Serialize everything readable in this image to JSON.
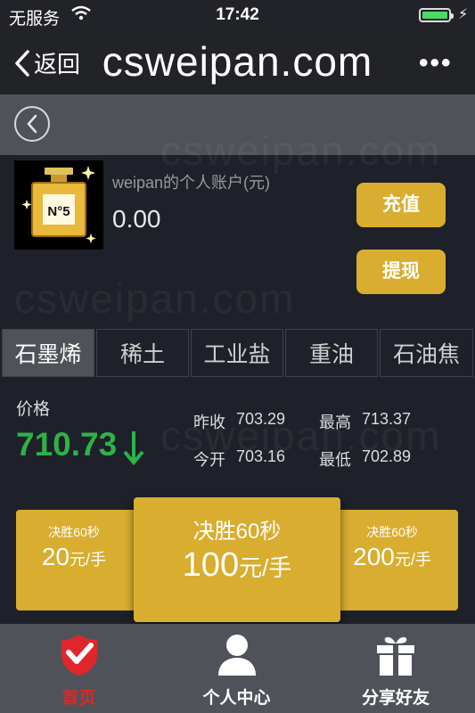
{
  "status_bar": {
    "carrier": "无服务",
    "time": "17:42"
  },
  "nav": {
    "back_label": "返回",
    "title": "csweipan.com",
    "more_label": "•••"
  },
  "account": {
    "title": "weipan的个人账户(元)",
    "balance": "0.00",
    "recharge_label": "充值",
    "withdraw_label": "提现"
  },
  "commodity_tabs": [
    "石墨烯",
    "稀土",
    "工业盐",
    "重油",
    "石油焦"
  ],
  "quote": {
    "price_label": "价格",
    "price": "710.73",
    "direction": "down",
    "prev_close_label": "昨收",
    "prev_close": "703.29",
    "high_label": "最高",
    "high": "713.37",
    "open_label": "今开",
    "open": "703.16",
    "low_label": "最低",
    "low": "702.89"
  },
  "contracts": {
    "left": {
      "caption": "决胜60秒",
      "amount": "20",
      "unit": "元/手"
    },
    "center": {
      "caption": "决胜60秒",
      "amount": "100",
      "unit": "元/手"
    },
    "right": {
      "caption": "决胜60秒",
      "amount": "200",
      "unit": "元/手"
    }
  },
  "tabbar": {
    "home_label": "首页",
    "profile_label": "个人中心",
    "share_label": "分享好友",
    "home_icon": "shield-check-icon",
    "profile_icon": "person-icon",
    "share_icon": "gift-icon"
  },
  "watermark": "csweipan.com",
  "colors": {
    "gold": "#d9ad2f",
    "price_green": "#2eb249",
    "active_tab_red": "#e0262a"
  }
}
